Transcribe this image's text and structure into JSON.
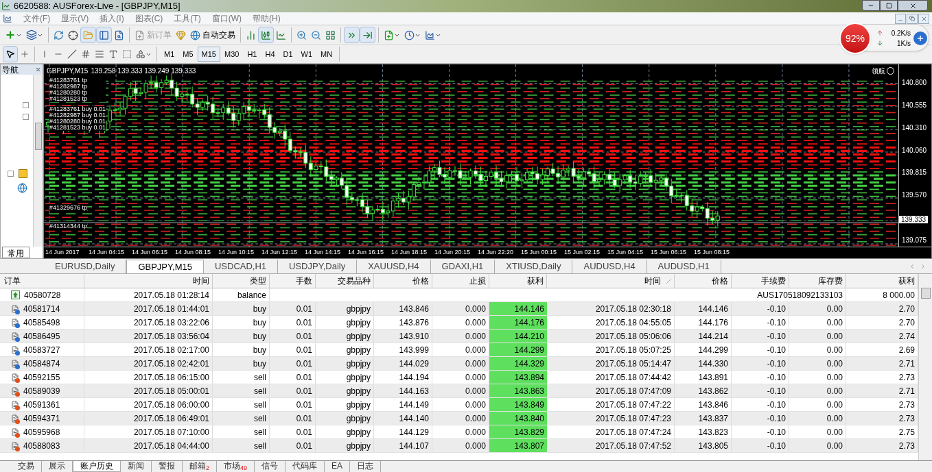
{
  "window": {
    "title": "6620588: AUSForex-Live - [GBPJPY,M15]"
  },
  "menu": [
    "文件(F)",
    "显示(V)",
    "插入(I)",
    "图表(C)",
    "工具(T)",
    "窗口(W)",
    "帮助(H)"
  ],
  "toolbar": {
    "new_order": "新订单",
    "auto_trading": "自动交易"
  },
  "timeframes": [
    {
      "label": "M1",
      "selected": false
    },
    {
      "label": "M5",
      "selected": false
    },
    {
      "label": "M15",
      "selected": true
    },
    {
      "label": "M30",
      "selected": false
    },
    {
      "label": "H1",
      "selected": false
    },
    {
      "label": "H4",
      "selected": false
    },
    {
      "label": "D1",
      "selected": false
    },
    {
      "label": "W1",
      "selected": false
    },
    {
      "label": "MN",
      "selected": false
    }
  ],
  "net_widget": {
    "percent": "92%",
    "upload": "0.2K/s",
    "download": "1K/s"
  },
  "navigator": {
    "title": "导航",
    "tab": "常用"
  },
  "chart": {
    "symbol": "GBPJPY,M15",
    "ohlc": "139.258 139.333 139.249 139.333",
    "badge": "领航",
    "order_labels_top": [
      "#41283761 tp",
      "#41282987 tp",
      "#41280280 tp",
      "#41281523 tp",
      "#41283761 buy 0.01",
      "#41282987 buy 0.01",
      "#41280280 buy 0.01",
      "#41281523 buy 0.01"
    ],
    "order_labels_bottom": [
      "#41329676 tp",
      "#41314344 tp"
    ],
    "price_labels": [
      "140.800",
      "140.555",
      "140.310",
      "140.060",
      "139.815",
      "139.570",
      "139.075"
    ],
    "current_price": "139.333",
    "time_labels": [
      "14 Jun 2017",
      "14 Jun 04:15",
      "14 Jun 06:15",
      "14 Jun 08:15",
      "14 Jun 10:15",
      "14 Jun 12:15",
      "14 Jun 14:15",
      "14 Jun 16:15",
      "14 Jun 18:15",
      "14 Jun 20:15",
      "14 Jun 22:20",
      "15 Jun 00:15",
      "15 Jun 02:15",
      "15 Jun 04:15",
      "15 Jun 06:15",
      "15 Jun 08:15"
    ]
  },
  "chart_tabs": [
    {
      "label": "EURUSD,Daily",
      "selected": false
    },
    {
      "label": "GBPJPY,M15",
      "selected": true
    },
    {
      "label": "USDCAD,H1",
      "selected": false
    },
    {
      "label": "USDJPY,Daily",
      "selected": false
    },
    {
      "label": "XAUUSD,H4",
      "selected": false
    },
    {
      "label": "GDAXI,H1",
      "selected": false
    },
    {
      "label": "XTIUSD,Daily",
      "selected": false
    },
    {
      "label": "AUDUSD,H4",
      "selected": false
    },
    {
      "label": "AUDUSD,H1",
      "selected": false
    }
  ],
  "history": {
    "columns": [
      "订单",
      "时间",
      "类型",
      "手数",
      "交易品种",
      "价格",
      "止损",
      "获利",
      "时间",
      "价格",
      "手续费",
      "库存费",
      "获利"
    ],
    "rows": [
      {
        "kind": "balance",
        "order": "40580728",
        "open_time": "2017.05.18 01:28:14",
        "type": "balance",
        "comment": "AUS170518092133103",
        "profit": "8 000.00"
      },
      {
        "kind": "buy",
        "order": "40581714",
        "open_time": "2017.05.18 01:44:01",
        "type": "buy",
        "lots": "0.01",
        "symbol": "gbpjpy",
        "price": "143.846",
        "sl": "0.000",
        "tp": "144.146",
        "tp_hit": true,
        "close_time": "2017.05.18 02:30:18",
        "close_price": "144.146",
        "commission": "-0.10",
        "swap": "0.00",
        "profit": "2.70"
      },
      {
        "kind": "buy",
        "order": "40585498",
        "open_time": "2017.05.18 03:22:06",
        "type": "buy",
        "lots": "0.01",
        "symbol": "gbpjpy",
        "price": "143.876",
        "sl": "0.000",
        "tp": "144.176",
        "tp_hit": true,
        "close_time": "2017.05.18 04:55:05",
        "close_price": "144.176",
        "commission": "-0.10",
        "swap": "0.00",
        "profit": "2.70"
      },
      {
        "kind": "buy",
        "order": "40586495",
        "open_time": "2017.05.18 03:56:04",
        "type": "buy",
        "lots": "0.01",
        "symbol": "gbpjpy",
        "price": "143.910",
        "sl": "0.000",
        "tp": "144.210",
        "tp_hit": true,
        "close_time": "2017.05.18 05:06:06",
        "close_price": "144.214",
        "commission": "-0.10",
        "swap": "0.00",
        "profit": "2.74"
      },
      {
        "kind": "buy",
        "order": "40583727",
        "open_time": "2017.05.18 02:17:00",
        "type": "buy",
        "lots": "0.01",
        "symbol": "gbpjpy",
        "price": "143.999",
        "sl": "0.000",
        "tp": "144.299",
        "tp_hit": true,
        "close_time": "2017.05.18 05:07:25",
        "close_price": "144.299",
        "commission": "-0.10",
        "swap": "0.00",
        "profit": "2.69"
      },
      {
        "kind": "buy",
        "order": "40584874",
        "open_time": "2017.05.18 02:42:01",
        "type": "buy",
        "lots": "0.01",
        "symbol": "gbpjpy",
        "price": "144.029",
        "sl": "0.000",
        "tp": "144.329",
        "tp_hit": true,
        "close_time": "2017.05.18 05:14:47",
        "close_price": "144.330",
        "commission": "-0.10",
        "swap": "0.00",
        "profit": "2.71"
      },
      {
        "kind": "sell",
        "order": "40592155",
        "open_time": "2017.05.18 06:15:00",
        "type": "sell",
        "lots": "0.01",
        "symbol": "gbpjpy",
        "price": "144.194",
        "sl": "0.000",
        "tp": "143.894",
        "tp_hit": true,
        "close_time": "2017.05.18 07:44:42",
        "close_price": "143.891",
        "commission": "-0.10",
        "swap": "0.00",
        "profit": "2.73"
      },
      {
        "kind": "sell",
        "order": "40589039",
        "open_time": "2017.05.18 05:00:01",
        "type": "sell",
        "lots": "0.01",
        "symbol": "gbpjpy",
        "price": "144.163",
        "sl": "0.000",
        "tp": "143.863",
        "tp_hit": true,
        "close_time": "2017.05.18 07:47:09",
        "close_price": "143.862",
        "commission": "-0.10",
        "swap": "0.00",
        "profit": "2.71"
      },
      {
        "kind": "sell",
        "order": "40591361",
        "open_time": "2017.05.18 06:00:00",
        "type": "sell",
        "lots": "0.01",
        "symbol": "gbpjpy",
        "price": "144.149",
        "sl": "0.000",
        "tp": "143.849",
        "tp_hit": true,
        "close_time": "2017.05.18 07:47:22",
        "close_price": "143.846",
        "commission": "-0.10",
        "swap": "0.00",
        "profit": "2.73"
      },
      {
        "kind": "sell",
        "order": "40594371",
        "open_time": "2017.05.18 06:49:01",
        "type": "sell",
        "lots": "0.01",
        "symbol": "gbpjpy",
        "price": "144.140",
        "sl": "0.000",
        "tp": "143.840",
        "tp_hit": true,
        "close_time": "2017.05.18 07:47:23",
        "close_price": "143.837",
        "commission": "-0.10",
        "swap": "0.00",
        "profit": "2.73"
      },
      {
        "kind": "sell",
        "order": "40595968",
        "open_time": "2017.05.18 07:10:00",
        "type": "sell",
        "lots": "0.01",
        "symbol": "gbpjpy",
        "price": "144.129",
        "sl": "0.000",
        "tp": "143.829",
        "tp_hit": true,
        "close_time": "2017.05.18 07:47:24",
        "close_price": "143.823",
        "commission": "-0.10",
        "swap": "0.00",
        "profit": "2.75"
      },
      {
        "kind": "sell",
        "order": "40588083",
        "open_time": "2017.05.18 04:44:00",
        "type": "sell",
        "lots": "0.01",
        "symbol": "gbpjpy",
        "price": "144.107",
        "sl": "0.000",
        "tp": "143.807",
        "tp_hit": true,
        "close_time": "2017.05.18 07:47:52",
        "close_price": "143.805",
        "commission": "-0.10",
        "swap": "0.00",
        "profit": "2.73"
      }
    ]
  },
  "bottom_tabs": [
    {
      "label": "交易",
      "selected": false
    },
    {
      "label": "展示",
      "selected": false
    },
    {
      "label": "账户历史",
      "selected": true
    },
    {
      "label": "新闻",
      "selected": false
    },
    {
      "label": "警报",
      "selected": false
    },
    {
      "label": "邮箱",
      "badge": "2",
      "selected": false
    },
    {
      "label": "市场",
      "badge": "49",
      "selected": false
    },
    {
      "label": "信号",
      "selected": false
    },
    {
      "label": "代码库",
      "selected": false
    },
    {
      "label": "EA",
      "selected": false
    },
    {
      "label": "日志",
      "selected": false
    }
  ]
}
